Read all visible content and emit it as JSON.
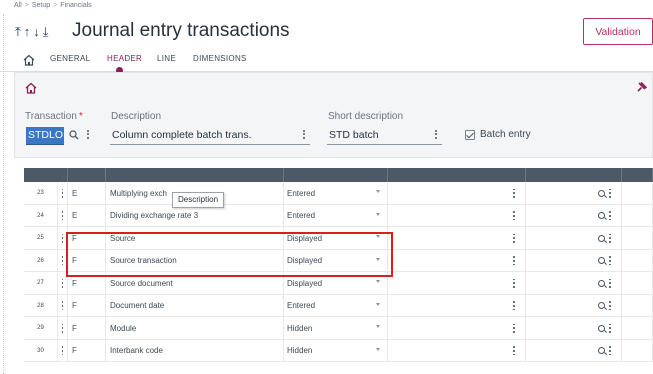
{
  "breadcrumb": [
    "All",
    "Setup",
    "Financials"
  ],
  "header": {
    "title": "Journal entry transactions",
    "validation_label": "Validation"
  },
  "tabs": [
    {
      "label": "GENERAL"
    },
    {
      "label": "HEADER",
      "active": true
    },
    {
      "label": "LINE"
    },
    {
      "label": "DIMENSIONS"
    }
  ],
  "form": {
    "transaction_label": "Transaction",
    "transaction_value": "STDLO",
    "description_label": "Description",
    "description_value": "Column complete batch trans.",
    "short_description_label": "Short description",
    "short_description_value": "STD batch",
    "batch_entry_label": "Batch entry",
    "batch_entry_checked": true
  },
  "tooltip": "Description",
  "rows": [
    {
      "num": "23",
      "type": "E",
      "description": "Multiplying exch",
      "entry_mode": "Entered"
    },
    {
      "num": "24",
      "type": "E",
      "description": "Dividing exchange rate 3",
      "entry_mode": "Entered"
    },
    {
      "num": "25",
      "type": "F",
      "description": "Source",
      "entry_mode": "Displayed"
    },
    {
      "num": "26",
      "type": "F",
      "description": "Source transaction",
      "entry_mode": "Displayed"
    },
    {
      "num": "27",
      "type": "F",
      "description": "Source document",
      "entry_mode": "Displayed"
    },
    {
      "num": "28",
      "type": "F",
      "description": "Document date",
      "entry_mode": "Entered"
    },
    {
      "num": "29",
      "type": "F",
      "description": "Module",
      "entry_mode": "Hidden"
    },
    {
      "num": "30",
      "type": "F",
      "description": "Interbank code",
      "entry_mode": "Hidden"
    }
  ],
  "colors": {
    "accent": "#8a1e55",
    "validation": "#b5306a",
    "grid_header": "#4c5966",
    "highlight": "#d42020",
    "selection": "#3a78c2"
  },
  "icons": [
    "sort-top-icon",
    "sort-up-icon",
    "sort-down-icon",
    "sort-bottom-icon",
    "home-icon",
    "pin-icon",
    "search-icon",
    "more-vertical-icon",
    "dropdown-caret-icon",
    "checkbox-checked-icon"
  ]
}
